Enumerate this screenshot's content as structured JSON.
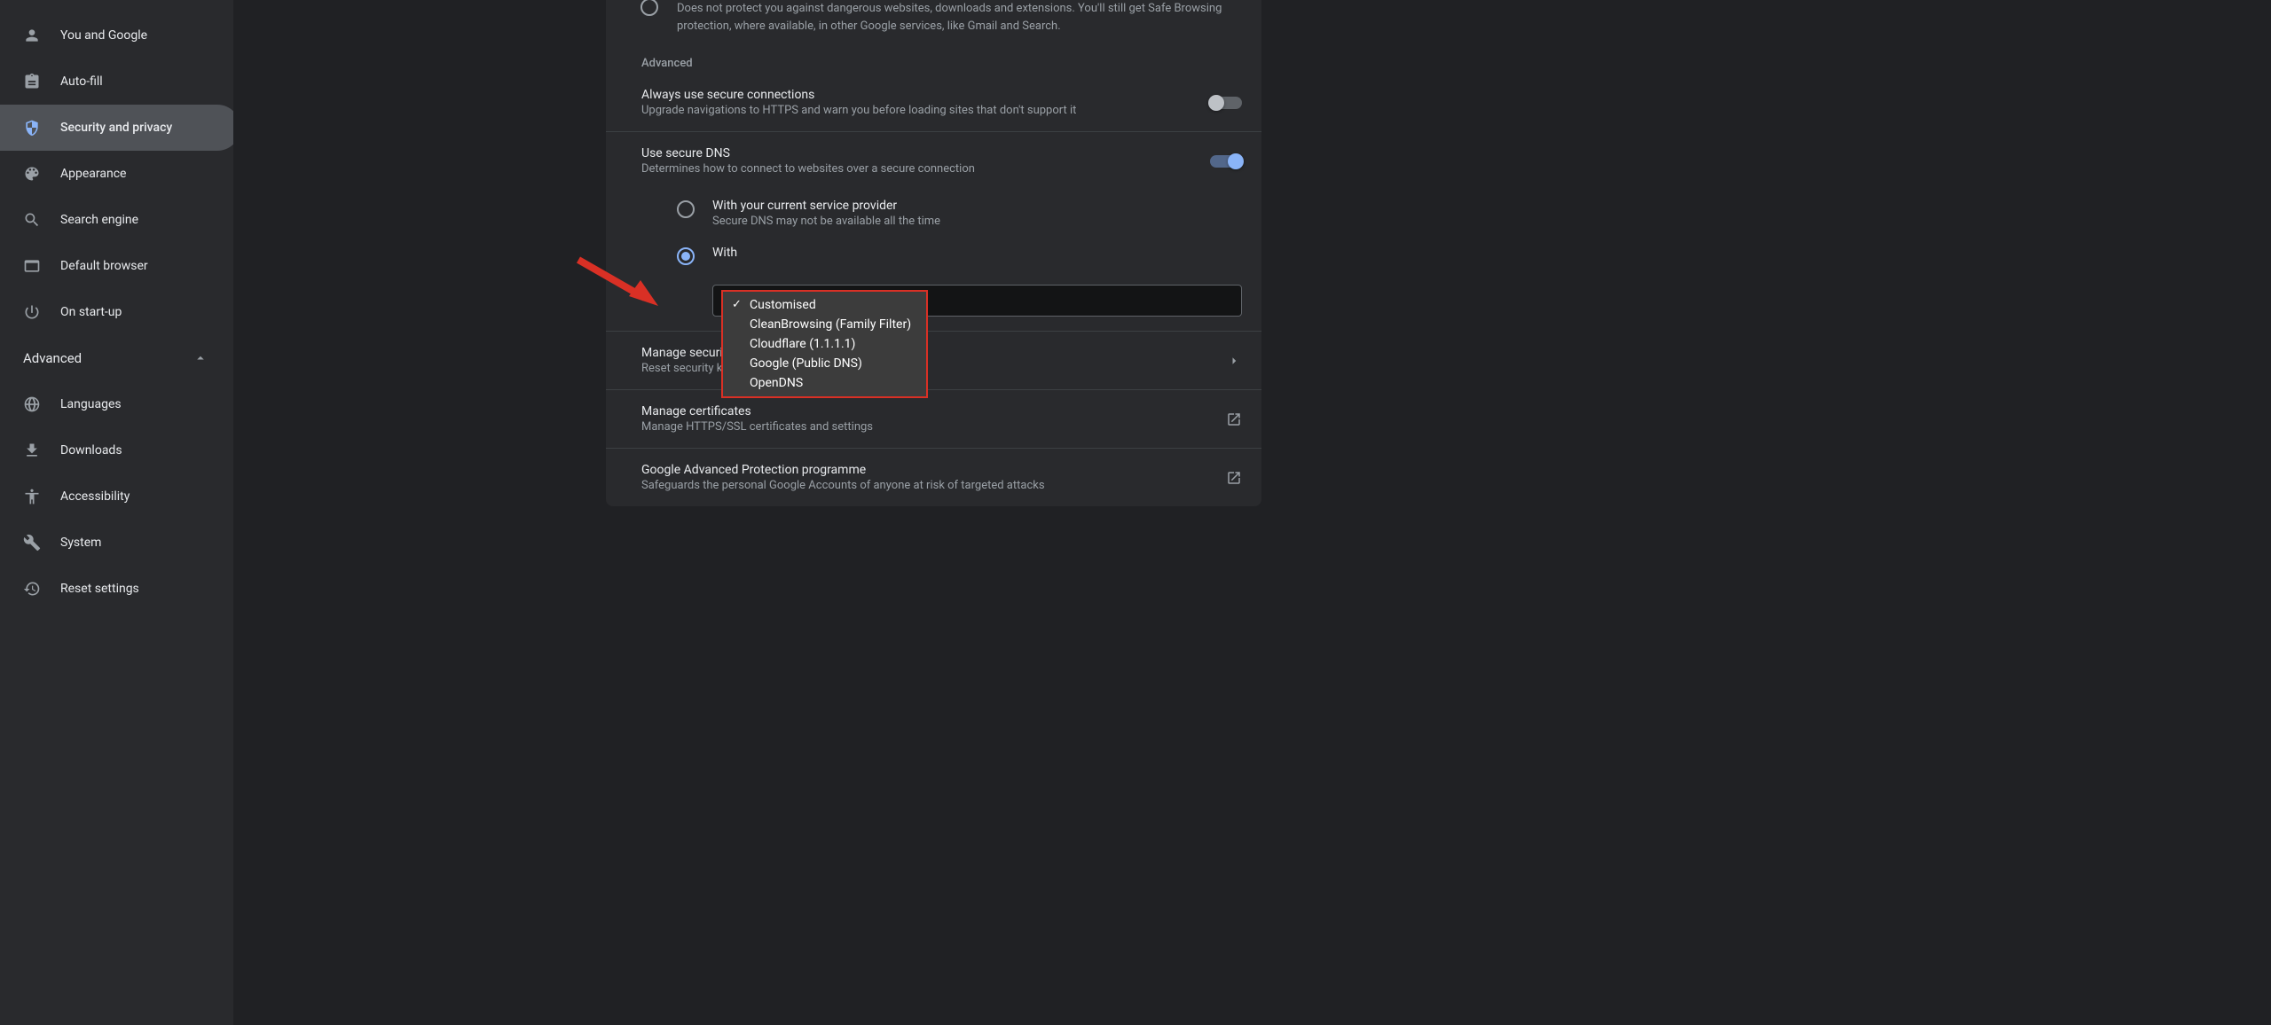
{
  "sidebar": {
    "items": [
      {
        "label": "You and Google"
      },
      {
        "label": "Auto-fill"
      },
      {
        "label": "Security and privacy"
      },
      {
        "label": "Appearance"
      },
      {
        "label": "Search engine"
      },
      {
        "label": "Default browser"
      },
      {
        "label": "On start-up"
      }
    ],
    "advanced_label": "Advanced",
    "advanced_items": [
      {
        "label": "Languages"
      },
      {
        "label": "Downloads"
      },
      {
        "label": "Accessibility"
      },
      {
        "label": "System"
      },
      {
        "label": "Reset settings"
      }
    ]
  },
  "main": {
    "partial_text": "Does not protect you against dangerous websites, downloads and extensions. You'll still get Safe Browsing protection, where available, in other Google services, like Gmail and Search.",
    "adv_label": "Advanced",
    "https": {
      "title": "Always use secure connections",
      "desc": "Upgrade navigations to HTTPS and warn you before loading sites that don't support it"
    },
    "dns": {
      "title": "Use secure DNS",
      "desc": "Determines how to connect to websites over a secure connection",
      "opt1_title": "With your current service provider",
      "opt1_desc": "Secure DNS may not be available all the time",
      "opt2_title": "With"
    },
    "sec_keys": {
      "title": "Manage security keys",
      "desc": "Reset security keys and create PINs"
    },
    "certs": {
      "title": "Manage certificates",
      "desc": "Manage HTTPS/SSL certificates and settings"
    },
    "gapp": {
      "title": "Google Advanced Protection programme",
      "desc": "Safeguards the personal Google Accounts of anyone at risk of targeted attacks"
    }
  },
  "dropdown": {
    "options": [
      "Customised",
      "CleanBrowsing (Family Filter)",
      "Cloudflare (1.1.1.1)",
      "Google (Public DNS)",
      "OpenDNS"
    ]
  }
}
